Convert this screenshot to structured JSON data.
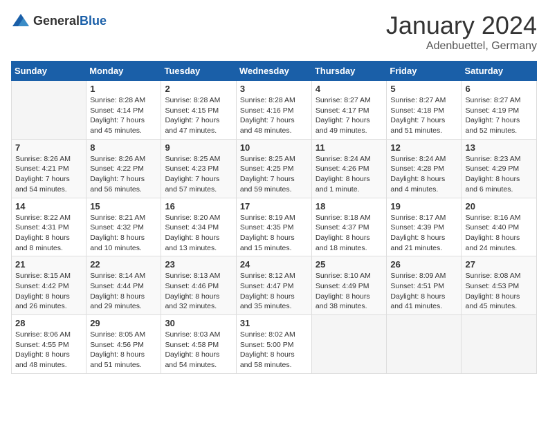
{
  "logo": {
    "text_general": "General",
    "text_blue": "Blue"
  },
  "title": "January 2024",
  "location": "Adenbuettel, Germany",
  "weekdays": [
    "Sunday",
    "Monday",
    "Tuesday",
    "Wednesday",
    "Thursday",
    "Friday",
    "Saturday"
  ],
  "weeks": [
    [
      {
        "day": "",
        "info": ""
      },
      {
        "day": "1",
        "info": "Sunrise: 8:28 AM\nSunset: 4:14 PM\nDaylight: 7 hours\nand 45 minutes."
      },
      {
        "day": "2",
        "info": "Sunrise: 8:28 AM\nSunset: 4:15 PM\nDaylight: 7 hours\nand 47 minutes."
      },
      {
        "day": "3",
        "info": "Sunrise: 8:28 AM\nSunset: 4:16 PM\nDaylight: 7 hours\nand 48 minutes."
      },
      {
        "day": "4",
        "info": "Sunrise: 8:27 AM\nSunset: 4:17 PM\nDaylight: 7 hours\nand 49 minutes."
      },
      {
        "day": "5",
        "info": "Sunrise: 8:27 AM\nSunset: 4:18 PM\nDaylight: 7 hours\nand 51 minutes."
      },
      {
        "day": "6",
        "info": "Sunrise: 8:27 AM\nSunset: 4:19 PM\nDaylight: 7 hours\nand 52 minutes."
      }
    ],
    [
      {
        "day": "7",
        "info": "Sunrise: 8:26 AM\nSunset: 4:21 PM\nDaylight: 7 hours\nand 54 minutes."
      },
      {
        "day": "8",
        "info": "Sunrise: 8:26 AM\nSunset: 4:22 PM\nDaylight: 7 hours\nand 56 minutes."
      },
      {
        "day": "9",
        "info": "Sunrise: 8:25 AM\nSunset: 4:23 PM\nDaylight: 7 hours\nand 57 minutes."
      },
      {
        "day": "10",
        "info": "Sunrise: 8:25 AM\nSunset: 4:25 PM\nDaylight: 7 hours\nand 59 minutes."
      },
      {
        "day": "11",
        "info": "Sunrise: 8:24 AM\nSunset: 4:26 PM\nDaylight: 8 hours\nand 1 minute."
      },
      {
        "day": "12",
        "info": "Sunrise: 8:24 AM\nSunset: 4:28 PM\nDaylight: 8 hours\nand 4 minutes."
      },
      {
        "day": "13",
        "info": "Sunrise: 8:23 AM\nSunset: 4:29 PM\nDaylight: 8 hours\nand 6 minutes."
      }
    ],
    [
      {
        "day": "14",
        "info": "Sunrise: 8:22 AM\nSunset: 4:31 PM\nDaylight: 8 hours\nand 8 minutes."
      },
      {
        "day": "15",
        "info": "Sunrise: 8:21 AM\nSunset: 4:32 PM\nDaylight: 8 hours\nand 10 minutes."
      },
      {
        "day": "16",
        "info": "Sunrise: 8:20 AM\nSunset: 4:34 PM\nDaylight: 8 hours\nand 13 minutes."
      },
      {
        "day": "17",
        "info": "Sunrise: 8:19 AM\nSunset: 4:35 PM\nDaylight: 8 hours\nand 15 minutes."
      },
      {
        "day": "18",
        "info": "Sunrise: 8:18 AM\nSunset: 4:37 PM\nDaylight: 8 hours\nand 18 minutes."
      },
      {
        "day": "19",
        "info": "Sunrise: 8:17 AM\nSunset: 4:39 PM\nDaylight: 8 hours\nand 21 minutes."
      },
      {
        "day": "20",
        "info": "Sunrise: 8:16 AM\nSunset: 4:40 PM\nDaylight: 8 hours\nand 24 minutes."
      }
    ],
    [
      {
        "day": "21",
        "info": "Sunrise: 8:15 AM\nSunset: 4:42 PM\nDaylight: 8 hours\nand 26 minutes."
      },
      {
        "day": "22",
        "info": "Sunrise: 8:14 AM\nSunset: 4:44 PM\nDaylight: 8 hours\nand 29 minutes."
      },
      {
        "day": "23",
        "info": "Sunrise: 8:13 AM\nSunset: 4:46 PM\nDaylight: 8 hours\nand 32 minutes."
      },
      {
        "day": "24",
        "info": "Sunrise: 8:12 AM\nSunset: 4:47 PM\nDaylight: 8 hours\nand 35 minutes."
      },
      {
        "day": "25",
        "info": "Sunrise: 8:10 AM\nSunset: 4:49 PM\nDaylight: 8 hours\nand 38 minutes."
      },
      {
        "day": "26",
        "info": "Sunrise: 8:09 AM\nSunset: 4:51 PM\nDaylight: 8 hours\nand 41 minutes."
      },
      {
        "day": "27",
        "info": "Sunrise: 8:08 AM\nSunset: 4:53 PM\nDaylight: 8 hours\nand 45 minutes."
      }
    ],
    [
      {
        "day": "28",
        "info": "Sunrise: 8:06 AM\nSunset: 4:55 PM\nDaylight: 8 hours\nand 48 minutes."
      },
      {
        "day": "29",
        "info": "Sunrise: 8:05 AM\nSunset: 4:56 PM\nDaylight: 8 hours\nand 51 minutes."
      },
      {
        "day": "30",
        "info": "Sunrise: 8:03 AM\nSunset: 4:58 PM\nDaylight: 8 hours\nand 54 minutes."
      },
      {
        "day": "31",
        "info": "Sunrise: 8:02 AM\nSunset: 5:00 PM\nDaylight: 8 hours\nand 58 minutes."
      },
      {
        "day": "",
        "info": ""
      },
      {
        "day": "",
        "info": ""
      },
      {
        "day": "",
        "info": ""
      }
    ]
  ]
}
